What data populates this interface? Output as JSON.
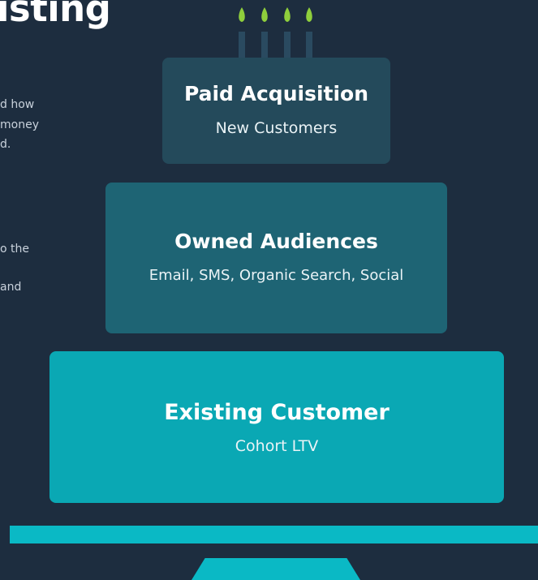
{
  "heading": "isting",
  "side_texts": [
    "d how",
    "money",
    "d.",
    "o the",
    "and"
  ],
  "tiers": {
    "top": {
      "title": "Paid Acquisition",
      "subtitle": "New Customers"
    },
    "middle": {
      "title": "Owned Audiences",
      "subtitle": "Email, SMS, Organic Search, Social"
    },
    "bottom": {
      "title": "Existing Customer",
      "subtitle": "Cohort LTV"
    }
  },
  "colors": {
    "background": "#1d2d3f",
    "top_tier": "#244a5b",
    "middle_tier": "#1e6474",
    "bottom_tier": "#0aa8b4",
    "plate": "#0ab9c5",
    "flame": "#8fcf3c",
    "candle": "#2a4a60"
  }
}
